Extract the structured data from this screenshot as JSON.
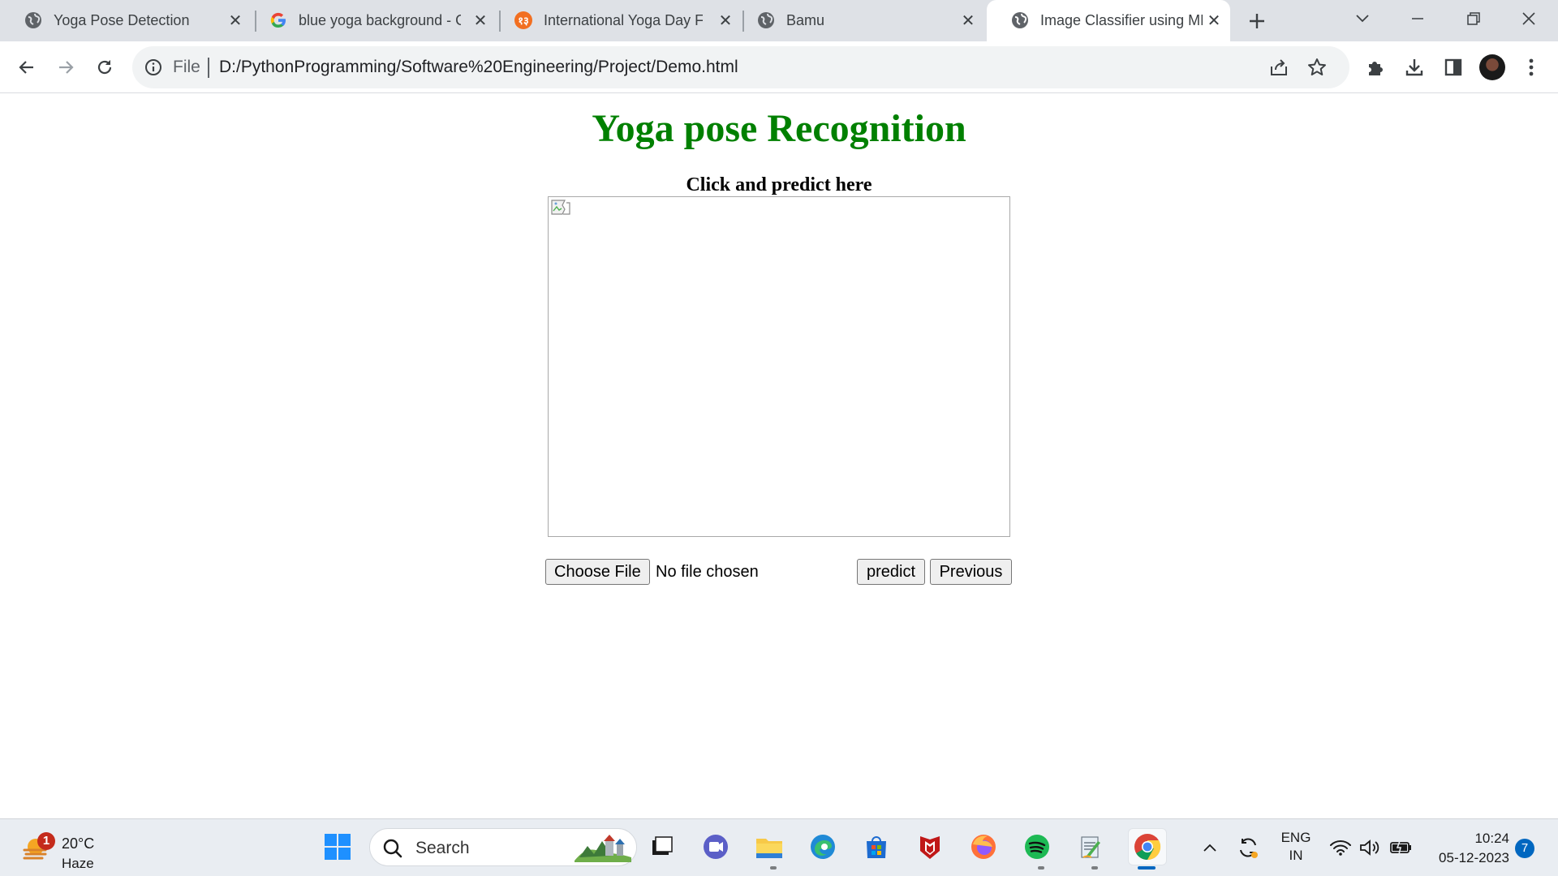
{
  "browser": {
    "tabs": [
      {
        "title": "Yoga Pose Detection",
        "favicon": "globe-icon",
        "active": false
      },
      {
        "title": "blue yoga background - G",
        "favicon": "google-icon",
        "active": false
      },
      {
        "title": "International Yoga Day Fr",
        "favicon": "brand-icon",
        "active": false
      },
      {
        "title": "Bamu",
        "favicon": "globe-icon",
        "active": false
      },
      {
        "title": "Image Classifier using ML",
        "favicon": "globe-icon",
        "active": true
      }
    ],
    "address": {
      "scheme": "File",
      "url": "D:/PythonProgramming/Software%20Engineering/Project/Demo.html"
    }
  },
  "page": {
    "title": "Yoga pose Recognition",
    "caption": "Click and predict here",
    "file_button": "Choose File",
    "file_status": "No file chosen",
    "predict_button": "predict",
    "previous_button": "Previous",
    "title_color": "#008000"
  },
  "taskbar": {
    "weather": {
      "temp": "20°C",
      "condition": "Haze",
      "badge": "1"
    },
    "search_label": "Search",
    "lang_line1": "ENG",
    "lang_line2": "IN",
    "time": "10:24",
    "date": "05-12-2023",
    "notifications": "7"
  }
}
